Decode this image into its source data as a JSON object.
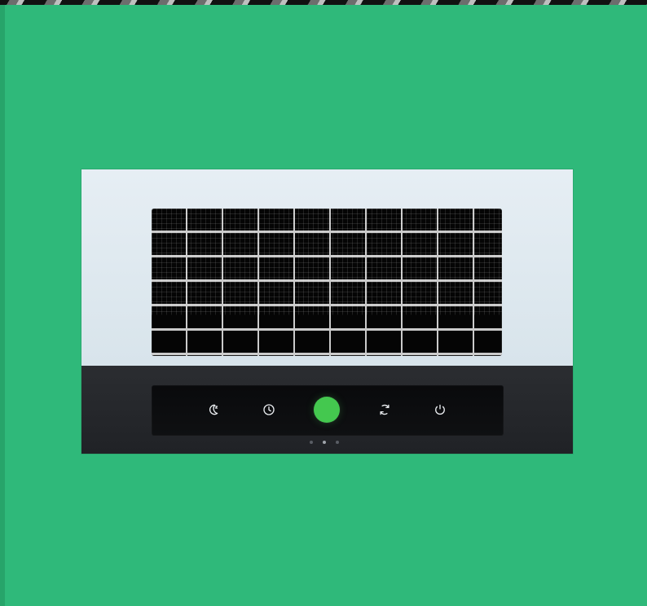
{
  "device": {
    "icons": [
      "sleep-mode-icon",
      "timer-icon",
      "power-indicator-icon",
      "auto-mode-icon",
      "power-icon"
    ],
    "accent_color": "#44c84f",
    "background_color": "#2fb97a"
  }
}
